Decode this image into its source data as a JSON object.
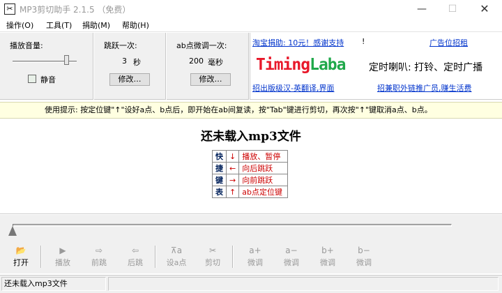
{
  "window": {
    "title": "MP3剪切助手 2.1.5 （免费）",
    "icon_name": "scissors-icon",
    "minimize_glyph": "—",
    "maximize_glyph": "☐",
    "close_glyph": "✕"
  },
  "menu": [
    "操作(O)",
    "工具(T)",
    "捐助(M)",
    "帮助(H)"
  ],
  "volume": {
    "label": "播放音量:",
    "level": 0.85,
    "mute_label": "静音",
    "mute_checked": false
  },
  "jump": {
    "label": "跳跃一次:",
    "value": "3",
    "unit": "秒",
    "button": "修改…"
  },
  "fine": {
    "label": "ab点微调一次:",
    "value": "200",
    "unit": "毫秒",
    "button": "修改…"
  },
  "ad": {
    "donate_link": "淘宝捐助: 10元！感谢支持",
    "donate_suffix": "!",
    "ad_link": "广告位招租",
    "brand_part1": "Timing",
    "brand_part2": "Laba",
    "tagline": "定时喇叭: 打铃、定时广播",
    "bottom_link1": "招出版级汉-英翻译,界面",
    "bottom_link2": "招兼职外链推广员,赚生活费",
    "colors": {
      "brand_red": "#e8182a",
      "brand_green": "#1fa84a",
      "link": "#0033cc"
    }
  },
  "tip": "使用提示: 按定位键\"↑\"设好a点、b点后，即开始在ab间复读，按\"Tab\"键进行剪切，再次按\"↑\"键取消a点、b点。",
  "main": {
    "title": "还未载入mp3文件",
    "shortcut_side": [
      "快",
      "捷",
      "键",
      "表"
    ],
    "shortcuts": [
      {
        "key": "↓",
        "desc": "播放、暂停"
      },
      {
        "key": "←",
        "desc": "向后跳跃"
      },
      {
        "key": "→",
        "desc": "向前跳跃"
      },
      {
        "key": "↑",
        "desc": "ab点定位键"
      }
    ]
  },
  "seek": {
    "position": 0
  },
  "toolbar": [
    {
      "label": "打开",
      "icon": "📂",
      "icon_name": "open-folder-icon",
      "enabled": true
    },
    {
      "label": "播放",
      "icon": "▶",
      "icon_name": "play-icon",
      "enabled": false
    },
    {
      "label": "前跳",
      "icon": "⇨",
      "icon_name": "forward-jump-icon",
      "enabled": false
    },
    {
      "label": "后跳",
      "icon": "⇦",
      "icon_name": "backward-jump-icon",
      "enabled": false
    },
    {
      "label": "设a点",
      "icon": "⊼a",
      "icon_name": "set-a-point-icon",
      "enabled": false
    },
    {
      "label": "剪切",
      "icon": "✂",
      "icon_name": "scissors-icon",
      "enabled": false
    },
    {
      "label": "微调",
      "icon": "a+",
      "icon_name": "a-plus-icon",
      "enabled": false
    },
    {
      "label": "微调",
      "icon": "a−",
      "icon_name": "a-minus-icon",
      "enabled": false
    },
    {
      "label": "微调",
      "icon": "b+",
      "icon_name": "b-plus-icon",
      "enabled": false
    },
    {
      "label": "微调",
      "icon": "b−",
      "icon_name": "b-minus-icon",
      "enabled": false
    }
  ],
  "status": {
    "text": "还未载入mp3文件"
  }
}
